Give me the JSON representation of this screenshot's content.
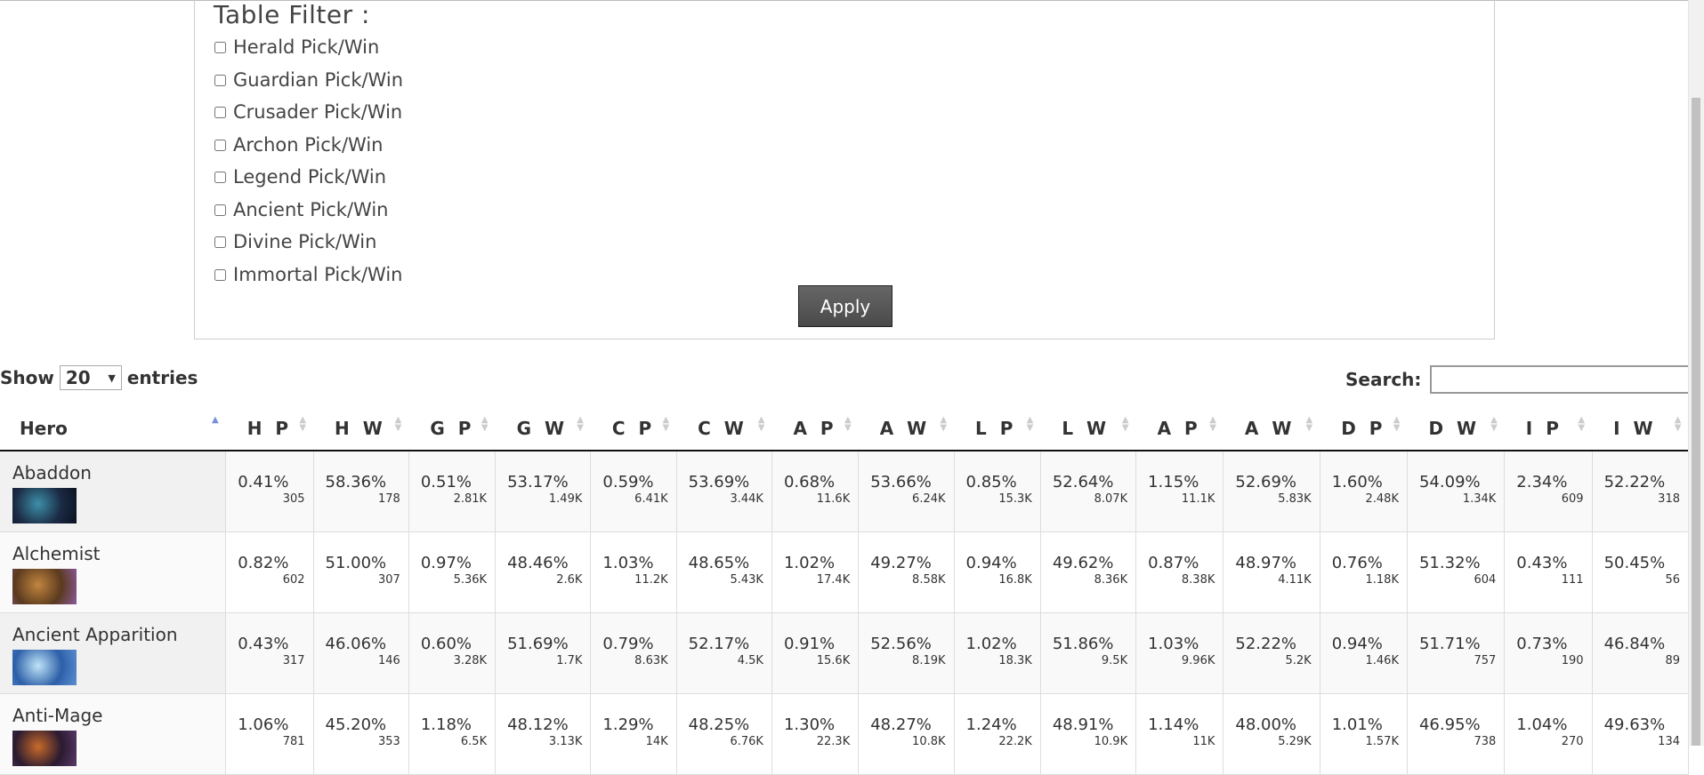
{
  "filter": {
    "title": "Table Filter :",
    "options": [
      {
        "label": "Herald Pick/Win",
        "checked": false
      },
      {
        "label": "Guardian Pick/Win",
        "checked": false
      },
      {
        "label": "Crusader Pick/Win",
        "checked": false
      },
      {
        "label": "Archon Pick/Win",
        "checked": false
      },
      {
        "label": "Legend Pick/Win",
        "checked": false
      },
      {
        "label": "Ancient Pick/Win",
        "checked": false
      },
      {
        "label": "Divine Pick/Win",
        "checked": false
      },
      {
        "label": "Immortal Pick/Win",
        "checked": false
      }
    ],
    "apply_label": "Apply"
  },
  "length": {
    "show_label": "Show",
    "value": "20",
    "entries_label": "entries"
  },
  "search": {
    "label": "Search:",
    "value": ""
  },
  "table": {
    "columns": [
      "Hero",
      "H P",
      "H W",
      "G P",
      "G W",
      "C P",
      "C W",
      "A P",
      "A W",
      "L P",
      "L W",
      "A P",
      "A W",
      "D P",
      "D W",
      "I P",
      "I W"
    ],
    "sorted_column": "Hero",
    "rows": [
      {
        "hero": "Abaddon",
        "icon": "abaddon-portrait",
        "colors": [
          "#1b2a44",
          "#3d8fa8",
          "#0a1220"
        ],
        "cells": [
          [
            "0.41%",
            "305"
          ],
          [
            "58.36%",
            "178"
          ],
          [
            "0.51%",
            "2.81K"
          ],
          [
            "53.17%",
            "1.49K"
          ],
          [
            "0.59%",
            "6.41K"
          ],
          [
            "53.69%",
            "3.44K"
          ],
          [
            "0.68%",
            "11.6K"
          ],
          [
            "53.66%",
            "6.24K"
          ],
          [
            "0.85%",
            "15.3K"
          ],
          [
            "52.64%",
            "8.07K"
          ],
          [
            "1.15%",
            "11.1K"
          ],
          [
            "52.69%",
            "5.83K"
          ],
          [
            "1.60%",
            "2.48K"
          ],
          [
            "54.09%",
            "1.34K"
          ],
          [
            "2.34%",
            "609"
          ],
          [
            "52.22%",
            "318"
          ]
        ]
      },
      {
        "hero": "Alchemist",
        "icon": "alchemist-portrait",
        "colors": [
          "#5a3a1e",
          "#c2853f",
          "#8a5a9a"
        ],
        "cells": [
          [
            "0.82%",
            "602"
          ],
          [
            "51.00%",
            "307"
          ],
          [
            "0.97%",
            "5.36K"
          ],
          [
            "48.46%",
            "2.6K"
          ],
          [
            "1.03%",
            "11.2K"
          ],
          [
            "48.65%",
            "5.43K"
          ],
          [
            "1.02%",
            "17.4K"
          ],
          [
            "49.27%",
            "8.58K"
          ],
          [
            "0.94%",
            "16.8K"
          ],
          [
            "49.62%",
            "8.36K"
          ],
          [
            "0.87%",
            "8.38K"
          ],
          [
            "48.97%",
            "4.11K"
          ],
          [
            "0.76%",
            "1.18K"
          ],
          [
            "51.32%",
            "604"
          ],
          [
            "0.43%",
            "111"
          ],
          [
            "50.45%",
            "56"
          ]
        ]
      },
      {
        "hero": "Ancient Apparition",
        "icon": "ancient-apparition-portrait",
        "colors": [
          "#2d5fa8",
          "#bfe4f7",
          "#5b8fd0"
        ],
        "cells": [
          [
            "0.43%",
            "317"
          ],
          [
            "46.06%",
            "146"
          ],
          [
            "0.60%",
            "3.28K"
          ],
          [
            "51.69%",
            "1.7K"
          ],
          [
            "0.79%",
            "8.63K"
          ],
          [
            "52.17%",
            "4.5K"
          ],
          [
            "0.91%",
            "15.6K"
          ],
          [
            "52.56%",
            "8.19K"
          ],
          [
            "1.02%",
            "18.3K"
          ],
          [
            "51.86%",
            "9.5K"
          ],
          [
            "1.03%",
            "9.96K"
          ],
          [
            "52.22%",
            "5.2K"
          ],
          [
            "0.94%",
            "1.46K"
          ],
          [
            "51.71%",
            "757"
          ],
          [
            "0.73%",
            "190"
          ],
          [
            "46.84%",
            "89"
          ]
        ]
      },
      {
        "hero": "Anti-Mage",
        "icon": "anti-mage-portrait",
        "colors": [
          "#2a1a30",
          "#c86a2a",
          "#5a3a6a"
        ],
        "cells": [
          [
            "1.06%",
            "781"
          ],
          [
            "45.20%",
            "353"
          ],
          [
            "1.18%",
            "6.5K"
          ],
          [
            "48.12%",
            "3.13K"
          ],
          [
            "1.29%",
            "14K"
          ],
          [
            "48.25%",
            "6.76K"
          ],
          [
            "1.30%",
            "22.3K"
          ],
          [
            "48.27%",
            "10.8K"
          ],
          [
            "1.24%",
            "22.2K"
          ],
          [
            "48.91%",
            "10.9K"
          ],
          [
            "1.14%",
            "11K"
          ],
          [
            "48.00%",
            "5.29K"
          ],
          [
            "1.01%",
            "1.57K"
          ],
          [
            "46.95%",
            "738"
          ],
          [
            "1.04%",
            "270"
          ],
          [
            "49.63%",
            "134"
          ]
        ]
      }
    ]
  }
}
